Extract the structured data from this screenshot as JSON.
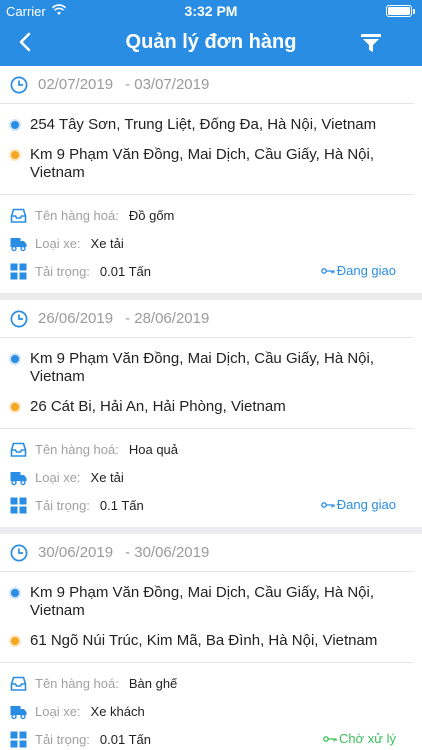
{
  "status_bar": {
    "carrier": "Carrier",
    "time": "3:32 PM"
  },
  "header": {
    "title": "Quản lý đơn hàng"
  },
  "labels": {
    "goods": "Tên hàng hoá:",
    "vehicle": "Loại xe:",
    "load": "Tải trọng:"
  },
  "colors": {
    "accent": "#2a8de4",
    "pickup_dot": "#2a8de4",
    "dropoff_dot": "#f5a623"
  },
  "icons": {
    "back": "chevron-left-icon",
    "filter": "funnel-icon",
    "date": "clock-icon",
    "goods": "inbox-icon",
    "vehicle": "truck-icon",
    "load": "grid-icon",
    "status": "key-icon"
  },
  "orders": [
    {
      "date_from": "02/07/2019",
      "date_to": "- 03/07/2019",
      "pickup": "254 Tây Sơn, Trung Liệt, Đống Đa, Hà Nội, Vietnam",
      "dropoff": "Km 9 Phạm Văn Đồng, Mai Dịch, Cầu Giấy, Hà Nội, Vietnam",
      "goods": "Đồ gốm",
      "vehicle": "Xe tải",
      "load": "0.01 Tấn",
      "status": "Đang giao"
    },
    {
      "date_from": "26/06/2019",
      "date_to": "- 28/06/2019",
      "pickup": "Km 9 Phạm Văn Đồng, Mai Dịch, Cầu Giấy, Hà Nội, Vietnam",
      "dropoff": "26 Cát Bi, Hải An, Hải Phòng, Vietnam",
      "goods": "Hoa quả",
      "vehicle": "Xe tải",
      "load": "0.1 Tấn",
      "status": "Đang giao"
    },
    {
      "date_from": "30/06/2019",
      "date_to": "- 30/06/2019",
      "pickup": "Km 9 Phạm Văn Đồng, Mai Dịch, Cầu Giấy, Hà Nội, Vietnam",
      "dropoff": "61 Ngõ Núi Trúc, Kim Mã, Ba Đình, Hà Nội, Vietnam",
      "goods": "Bàn ghế",
      "vehicle": "Xe khách",
      "load": "0.01 Tấn",
      "status": "Chờ xử lý"
    }
  ]
}
